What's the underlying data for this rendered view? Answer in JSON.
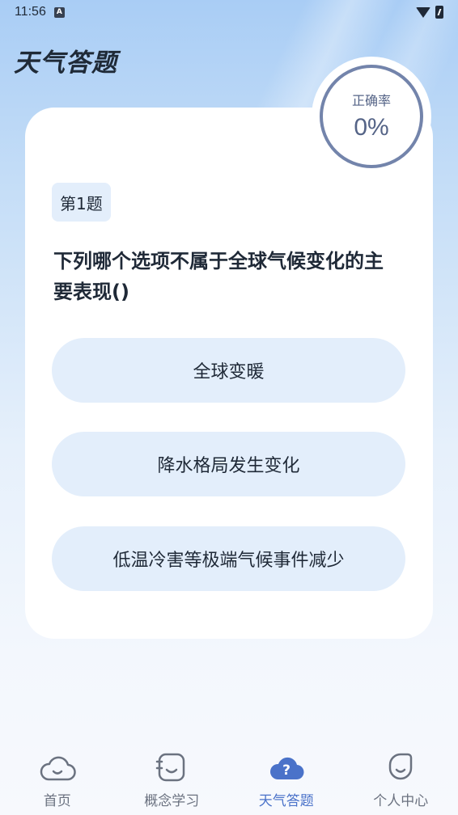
{
  "status": {
    "time": "11:56",
    "a_icon": "A"
  },
  "app_title": "天气答题",
  "accuracy": {
    "label": "正确率",
    "value": "0%"
  },
  "question": {
    "number_label": "第1题",
    "text": "下列哪个选项不属于全球气候变化的主要表现()",
    "options": [
      "全球变暖",
      "降水格局发生变化",
      "低温冷害等极端气候事件减少"
    ]
  },
  "tabbar": {
    "items": [
      {
        "label": "首页",
        "icon": "cloud-face-icon"
      },
      {
        "label": "概念学习",
        "icon": "notebook-icon"
      },
      {
        "label": "天气答题",
        "icon": "question-cloud-icon"
      },
      {
        "label": "个人中心",
        "icon": "profile-face-icon"
      }
    ],
    "active_color": "#4a72c9",
    "inactive_color": "#6b7280"
  }
}
